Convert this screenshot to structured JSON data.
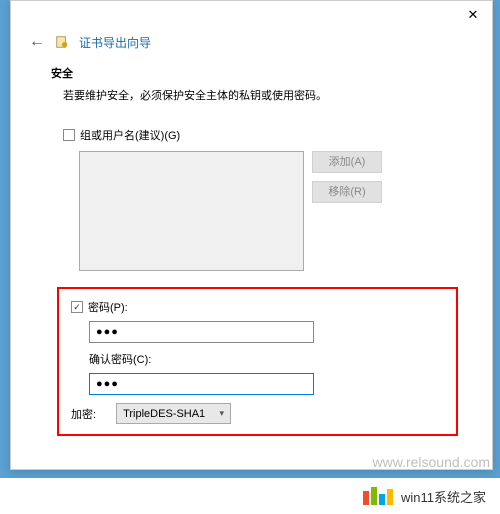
{
  "window": {
    "title": "证书导出向导"
  },
  "security": {
    "heading": "安全",
    "desc": "若要维护安全，必须保护安全主体的私钥或使用密码。"
  },
  "group": {
    "checkbox_label": "组或用户名(建议)(G)",
    "add_btn": "添加(A)",
    "remove_btn": "移除(R)"
  },
  "password": {
    "checkbox_label": "密码(P):",
    "value": "●●●",
    "confirm_label": "确认密码(C):",
    "confirm_value": "●●●"
  },
  "encryption": {
    "label": "加密:",
    "selected": "TripleDES-SHA1"
  },
  "branding": {
    "text": "win11系统之家"
  },
  "watermark": "www.relsound.com"
}
